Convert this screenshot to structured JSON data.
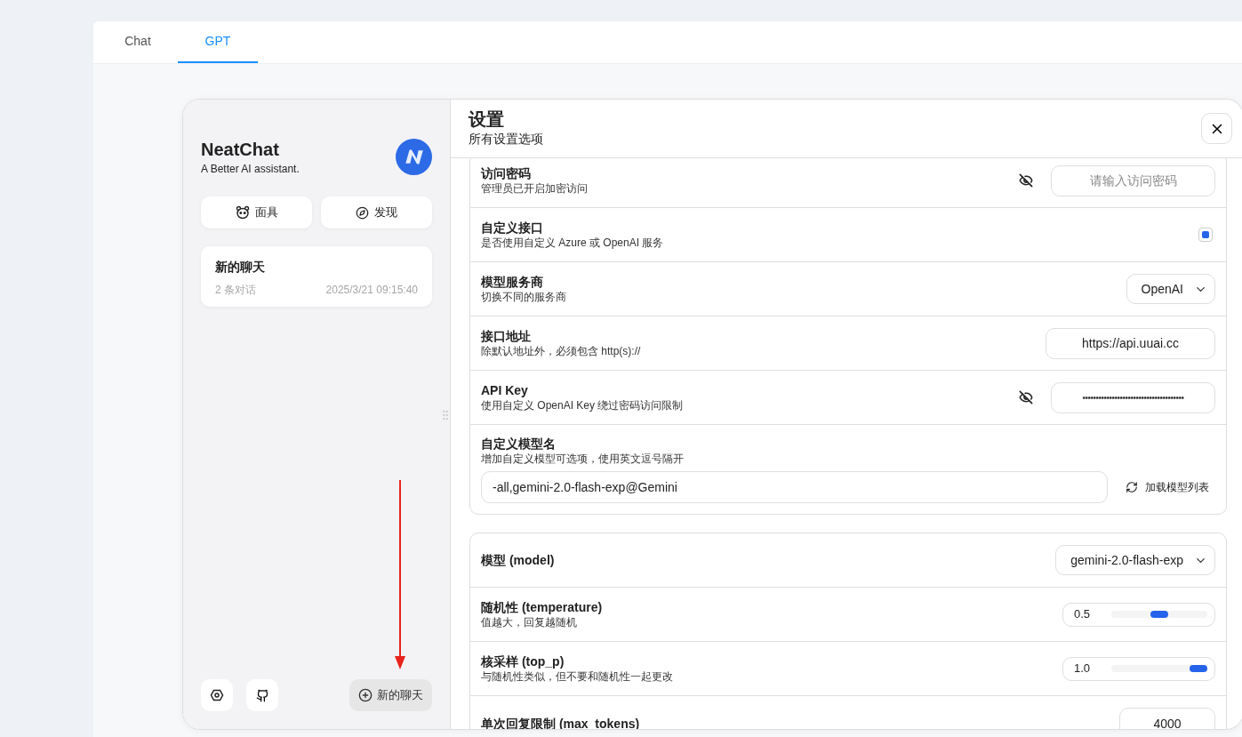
{
  "tabs": [
    {
      "label": "Chat",
      "selected": false
    },
    {
      "label": "GPT",
      "selected": true
    }
  ],
  "sidebar": {
    "title": "NeatChat",
    "subtitle": "A Better AI assistant.",
    "buttons": [
      {
        "kind": "mask",
        "label": "面具"
      },
      {
        "kind": "discover",
        "label": "发现"
      }
    ],
    "chats": [
      {
        "title": "新的聊天",
        "count": "2 条对话",
        "time": "2025/3/21 09:15:40"
      }
    ],
    "new_chat": "新的聊天"
  },
  "settings": {
    "title": "设置",
    "subtitle": "所有设置选项",
    "groups": [
      [
        {
          "kind": "password",
          "label": "访问密码",
          "description": "管理员已开启加密访问",
          "placeholder": "请输入访问密码"
        },
        {
          "kind": "checkbox",
          "label": "自定义接口",
          "description": "是否使用自定义 Azure 或 OpenAI 服务",
          "checked": true
        },
        {
          "kind": "select",
          "label": "模型服务商",
          "description": "切换不同的服务商",
          "value": "OpenAI"
        },
        {
          "kind": "text",
          "label": "接口地址",
          "description": "除默认地址外，必须包含 http(s)://",
          "value": "https://api.uuai.cc"
        },
        {
          "kind": "password",
          "label": "API Key",
          "description": "使用自定义 OpenAI Key 绕过密码访问限制",
          "value": "••••••••••••••••••••••••••••••••••••••"
        },
        {
          "kind": "models",
          "label": "自定义模型名",
          "description": "增加自定义模型可选项，使用英文逗号隔开",
          "value": "-all,gemini-2.0-flash-exp@Gemini",
          "button": "加载模型列表"
        }
      ],
      [
        {
          "kind": "select",
          "label": "模型 (model)",
          "value": "gemini-2.0-flash-exp"
        },
        {
          "kind": "slider",
          "label": "随机性 (temperature)",
          "description": "值越大，回复越随机",
          "value": "0.5",
          "level": 0.5
        },
        {
          "kind": "slider",
          "label": "核采样 (top_p)",
          "description": "与随机性类似，但不要和随机性一起更改",
          "value": "1.0",
          "level": 1.0
        },
        {
          "kind": "number",
          "label": "单次回复限制 (max_tokens)",
          "value": "4000"
        }
      ]
    ]
  }
}
